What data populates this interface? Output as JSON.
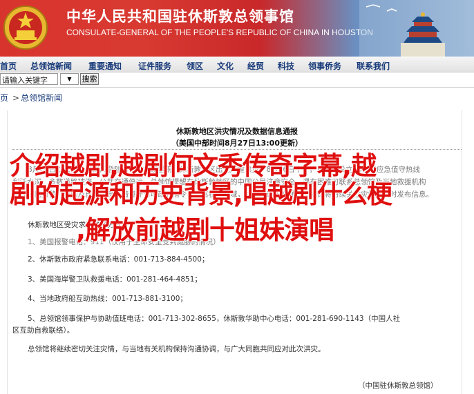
{
  "banner": {
    "title": "中华人民共和国驻休斯敦总领事馆",
    "subtitle": "CONSULATE-GENERAL OF THE PEOPLE'S REPUBLIC OF CHINA IN HOUSTON",
    "colors": {
      "red": "#d8342e",
      "sky": "#9cb9d8"
    }
  },
  "nav": {
    "items": [
      "首页",
      "总领馆新闻",
      "重要通知",
      "证件服务",
      "领区",
      "文化",
      "经贸",
      "科技",
      "领事侨务",
      "联系我们"
    ]
  },
  "search": {
    "value": "请输入关键字",
    "select_icon": "dropdown-arrow-icon",
    "button_label": "搜索"
  },
  "breadcrumb": {
    "items": [
      "页",
      "总领馆新闻"
    ],
    "separator": ">"
  },
  "article": {
    "title": "休斯敦地区洪灾情况及数据信息通报",
    "subtitle": "（美国中部时间8月27日13:00更新）",
    "lines": [
      "8月26日以来，哈维飓风登陆后带来持续暴雨，休斯敦地区出现严重洪灾。8月26日下午，总领馆设立24小时应急值守热线",
      "利沃水深，多数道路被淹，公共交通停运。总领馆提醒在休斯敦地区的中国公民注意安全，遇有困难可联系总领馆及当地救援机构",
      "中国公民报警、求助及自救信息，请遵守当地政府指令，远离积水区域，并保持通讯畅通。总领馆将持续关注灾情并及时发布信息。",
      "休斯敦地区受灾求助联系方式：",
      "1、美国报警电话：911（仅用于生命安全受到威胁的情况）",
      "2、休斯敦市政府紧急联系电话：001-713-884-4500；",
      "3、美国海岸警卫队救援电话：001-281-464-4851；",
      "4、当地政府船互助热线：001-713-881-3100；",
      "5、总领馆领事保护与协助值班电话：001-713-302-8655，休斯敦华助中心电话：001-281-690-1143（中国人社",
      "区互助自救联络）。",
      "总领馆将继续密切关注灾情，与当地有关机构保持沟通协调，与广大同胞共同应对此次洪灾。"
    ],
    "signature": "（中国驻休斯敦总领馆）"
  },
  "overlay": {
    "lines": [
      "介绍越剧,越剧何文秀传奇字幕,越",
      "剧的起源和历史背景,唱越剧什么梗",
      ",解放前越剧十姐妹演唱"
    ],
    "color": "#e01010"
  }
}
